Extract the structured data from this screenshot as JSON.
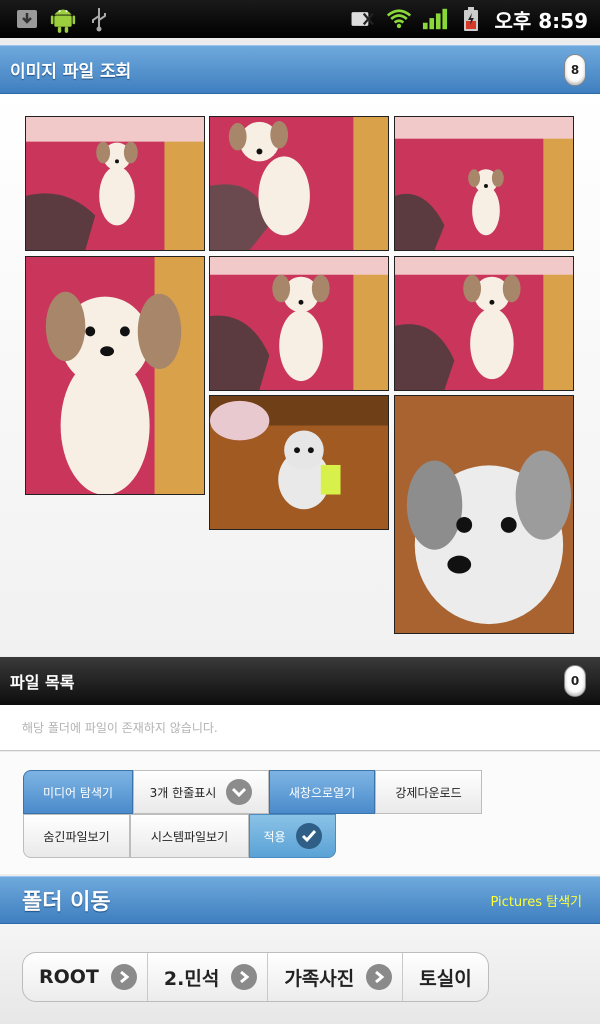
{
  "status_bar": {
    "icons": [
      "download-icon",
      "android-icon",
      "usb-icon",
      "sd-card-icon",
      "wifi-icon",
      "signal-icon",
      "battery-icon"
    ],
    "time": "오후 8:59"
  },
  "image_section": {
    "title": "이미지 파일 조회",
    "count": "8"
  },
  "file_section": {
    "title": "파일 목록",
    "count": "0",
    "empty_message": "해당 폴더에 파일이 존재하지 않습니다."
  },
  "toolbar": {
    "media_explorer": "미디어 탐색기",
    "three_per_row": "3개 한줄표시",
    "open_new_window": "새창으로열기",
    "force_download": "강제다운로드",
    "show_hidden": "숨긴파일보기",
    "show_system": "시스템파일보기",
    "apply": "적용"
  },
  "folder_section": {
    "title": "폴더 이동",
    "explorer_link": "Pictures 탐색기"
  },
  "breadcrumb": [
    "ROOT",
    "2.민석",
    "가족사진",
    "토실이"
  ],
  "colors": {
    "header_blue": "#4f8fcf",
    "apply_blue": "#5aa2d6",
    "link_yellow": "#ffff33"
  }
}
